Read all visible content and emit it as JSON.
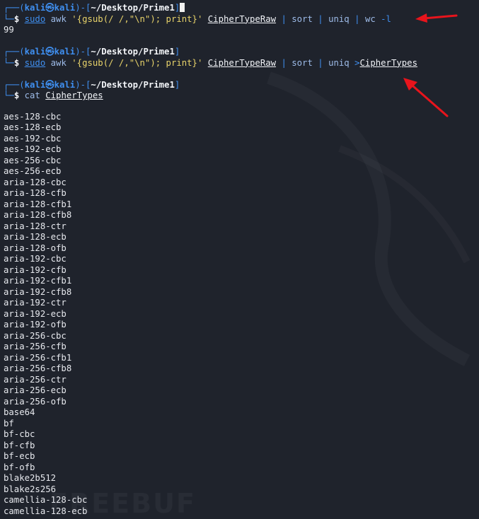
{
  "prompt": {
    "user": "kali",
    "host": "kali",
    "at": "㉿",
    "path": "~/Desktop/Prime1",
    "dollar": "$"
  },
  "commands": [
    {
      "sudo": "sudo",
      "tool": "awk",
      "script": "'{gsub(/ /,\"\\n\"); print}'",
      "file": "CipherTypeRaw",
      "pipe1": "|",
      "sort": "sort",
      "pipe2": "|",
      "uniq": "uniq",
      "pipe3": "|",
      "wc": "wc",
      "wc_flag": "-l",
      "output": "99"
    },
    {
      "sudo": "sudo",
      "tool": "awk",
      "script": "'{gsub(/ /,\"\\n\"); print}'",
      "file": "CipherTypeRaw",
      "pipe1": "|",
      "sort": "sort",
      "pipe2": "|",
      "uniq": "uniq",
      "redirect": ">",
      "outfile": "CipherTypes"
    },
    {
      "tool": "cat",
      "file": "CipherTypes"
    }
  ],
  "cipher_list": [
    "aes-128-cbc",
    "aes-128-ecb",
    "aes-192-cbc",
    "aes-192-ecb",
    "aes-256-cbc",
    "aes-256-ecb",
    "aria-128-cbc",
    "aria-128-cfb",
    "aria-128-cfb1",
    "aria-128-cfb8",
    "aria-128-ctr",
    "aria-128-ecb",
    "aria-128-ofb",
    "aria-192-cbc",
    "aria-192-cfb",
    "aria-192-cfb1",
    "aria-192-cfb8",
    "aria-192-ctr",
    "aria-192-ecb",
    "aria-192-ofb",
    "aria-256-cbc",
    "aria-256-cfb",
    "aria-256-cfb1",
    "aria-256-cfb8",
    "aria-256-ctr",
    "aria-256-ecb",
    "aria-256-ofb",
    "base64",
    "bf",
    "bf-cbc",
    "bf-cfb",
    "bf-ecb",
    "bf-ofb",
    "blake2b512",
    "blake2s256",
    "camellia-128-cbc",
    "camellia-128-ecb"
  ],
  "watermark": "FREEBUF",
  "colors": {
    "background": "#1f232c",
    "prompt_blue": "#3f8ff0",
    "string_yellow": "#e8d36a",
    "arrow_red": "#e8141c"
  },
  "icons": {
    "annotation_arrow": "red-arrow-icon",
    "cursor": "block-cursor"
  }
}
